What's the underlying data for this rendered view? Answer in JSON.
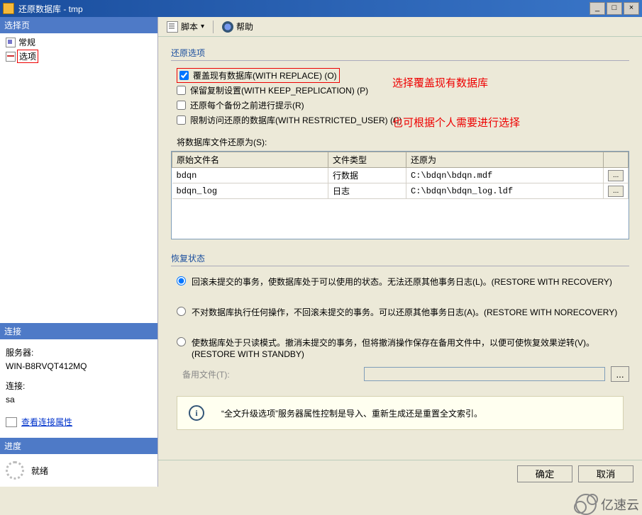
{
  "window": {
    "title": "还原数据库 - tmp",
    "min": "_",
    "max": "□",
    "close": "×"
  },
  "sidebar": {
    "select_page_header": "选择页",
    "items": [
      {
        "label": "常规",
        "icon": "general"
      },
      {
        "label": "选项",
        "icon": "options",
        "highlighted": true
      }
    ],
    "connection_header": "连接",
    "server_label": "服务器:",
    "server_value": "WIN-B8RVQT412MQ",
    "conn_label": "连接:",
    "conn_value": "sa",
    "view_props_link": "查看连接属性",
    "progress_header": "进度",
    "progress_status": "就绪"
  },
  "toolbar": {
    "script_label": "脚本",
    "help_label": "帮助"
  },
  "restore_options": {
    "section_title": "还原选项",
    "overwrite": "覆盖现有数据库(WITH REPLACE) (O)",
    "keep_replication": "保留复制设置(WITH KEEP_REPLICATION) (P)",
    "prompt_each": "还原每个备份之前进行提示(R)",
    "restricted": "限制访问还原的数据库(WITH RESTRICTED_USER) (C)"
  },
  "annotations": {
    "a1": "选择覆盖现有数据库",
    "a2": "也可根据个人需要进行选择"
  },
  "file_restore": {
    "label": "将数据库文件还原为(S):",
    "columns": {
      "orig": "原始文件名",
      "type": "文件类型",
      "as": "还原为"
    },
    "rows": [
      {
        "orig": "bdqn",
        "type": "行数据",
        "as": "C:\\bdqn\\bdqn.mdf"
      },
      {
        "orig": "bdqn_log",
        "type": "日志",
        "as": "C:\\bdqn\\bdqn_log.ldf"
      }
    ],
    "browse": "..."
  },
  "recovery": {
    "section_title": "恢复状态",
    "opt1": "回滚未提交的事务，使数据库处于可以使用的状态。无法还原其他事务日志(L)。(RESTORE WITH RECOVERY)",
    "opt2": "不对数据库执行任何操作，不回滚未提交的事务。可以还原其他事务日志(A)。(RESTORE WITH NORECOVERY)",
    "opt3": "使数据库处于只读模式。撤消未提交的事务，但将撤消操作保存在备用文件中，以便可使恢复效果逆转(V)。(RESTORE WITH STANDBY)",
    "standby_label": "备用文件(T):",
    "browse": "..."
  },
  "info_bar": {
    "text": "“全文升级选项”服务器属性控制是导入、重新生成还是重置全文索引。"
  },
  "footer": {
    "ok": "确定",
    "cancel": "取消"
  },
  "watermark": "亿速云"
}
